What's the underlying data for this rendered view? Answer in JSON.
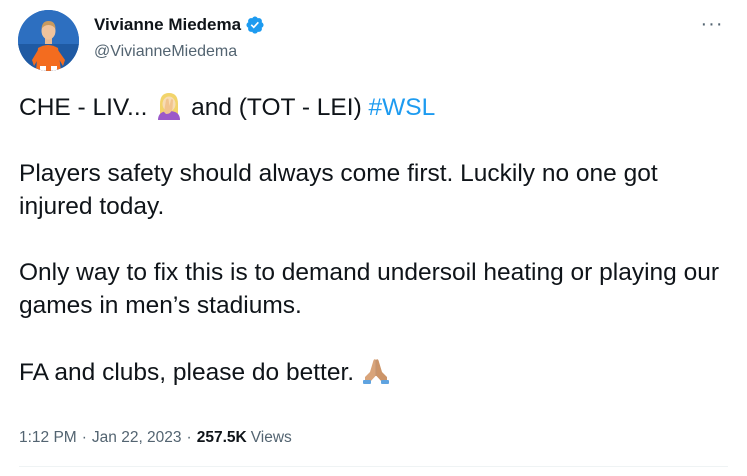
{
  "author": {
    "display_name": "Vivianne Miedema",
    "handle": "@VivianneMiedema",
    "verified": true,
    "avatar_icon": "player-in-orange-kit-avatar"
  },
  "more_button": {
    "label": "···",
    "icon": "more-horizontal-icon"
  },
  "tweet": {
    "line1_part1": "CHE - LIV... ",
    "line1_emoji": "woman-facepalming-emoji",
    "line1_part2": " and (TOT - LEI) ",
    "hashtag": "#WSL",
    "para2": "Players safety should always come first. Luckily no one got injured today.",
    "para3": "Only way to fix this is to demand undersoil heating or playing our games in men’s stadiums.",
    "para4_text": "FA and clubs, please do better. ",
    "para4_emoji": "folded-hands-emoji"
  },
  "meta": {
    "time": "1:12 PM",
    "separator": "·",
    "date": "Jan 22, 2023",
    "views_count": "257.5K",
    "views_label": "Views"
  },
  "colors": {
    "link": "#1d9bf0",
    "secondary_text": "#536471",
    "primary_text": "#0f1419",
    "verified_badge": "#1d9bf0"
  }
}
